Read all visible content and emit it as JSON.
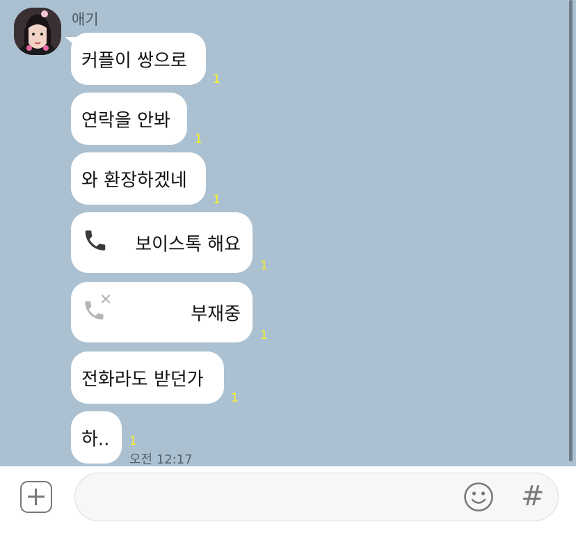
{
  "conversation": {
    "sender_name": "애기",
    "messages": [
      {
        "text": "커플이 쌍으로",
        "read": "1"
      },
      {
        "text": "연락을 안봐",
        "read": "1"
      },
      {
        "text": "와 환장하겠네",
        "read": "1"
      },
      {
        "type": "voice-call",
        "icon": "phone-icon",
        "text": "보이스톡 해요",
        "read": "1"
      },
      {
        "type": "missed-call",
        "icon": "missed-call-icon",
        "text": "부재중",
        "read": "1"
      },
      {
        "text": "전화라도 받던가",
        "read": "1"
      },
      {
        "text": "하..",
        "read": "1"
      }
    ],
    "timestamp": "오전 12:17"
  },
  "input_bar": {
    "plus_icon": "plus-square-icon",
    "placeholder": "",
    "value": "",
    "emoji_icon": "smiley-icon",
    "hash_label": "#"
  },
  "colors": {
    "background": "#abc1d1",
    "bubble": "#ffffff",
    "read_count": "#fdf21b",
    "input_bg": "#ffffff"
  }
}
